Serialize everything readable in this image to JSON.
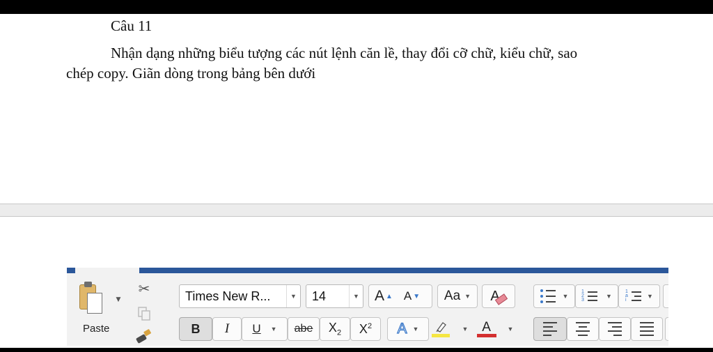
{
  "document": {
    "heading": "Câu 11",
    "paragraph_line1": "Nhận dạng những biểu tượng các nút lệnh căn lề, thay đổi cỡ chữ, kiểu chữ, sao",
    "paragraph_line2": "chép copy. Giãn dòng  trong bảng bên dưới"
  },
  "ribbon": {
    "accent_color": "#2b579a",
    "clipboard": {
      "paste_label": "Paste",
      "icons": [
        "paste-clipboard-icon",
        "cut-scissors-icon",
        "copy-icon",
        "format-painter-icon"
      ]
    },
    "font": {
      "font_name": "Times New R...",
      "font_size": "14",
      "grow_label": "A",
      "shrink_label": "A",
      "change_case_label": "Aa",
      "clear_format_label": "A",
      "bold": "B",
      "italic": "I",
      "underline": "U",
      "strikethrough": "abe",
      "subscript_base": "X",
      "subscript_index": "2",
      "superscript_base": "X",
      "superscript_index": "2",
      "text_effects_label": "A",
      "font_color_label": "A",
      "font_color": "#d32f2f",
      "highlight_color": "#f5e642",
      "text_effects_color": "#3a78c9"
    },
    "paragraph": {
      "icons": [
        "bullets-icon",
        "numbering-icon",
        "multilevel-list-icon",
        "align-left-icon",
        "align-center-icon",
        "align-right-icon",
        "justify-icon"
      ],
      "numbering_digits": "1 2 3",
      "multilevel_digits": "1 a i"
    }
  }
}
